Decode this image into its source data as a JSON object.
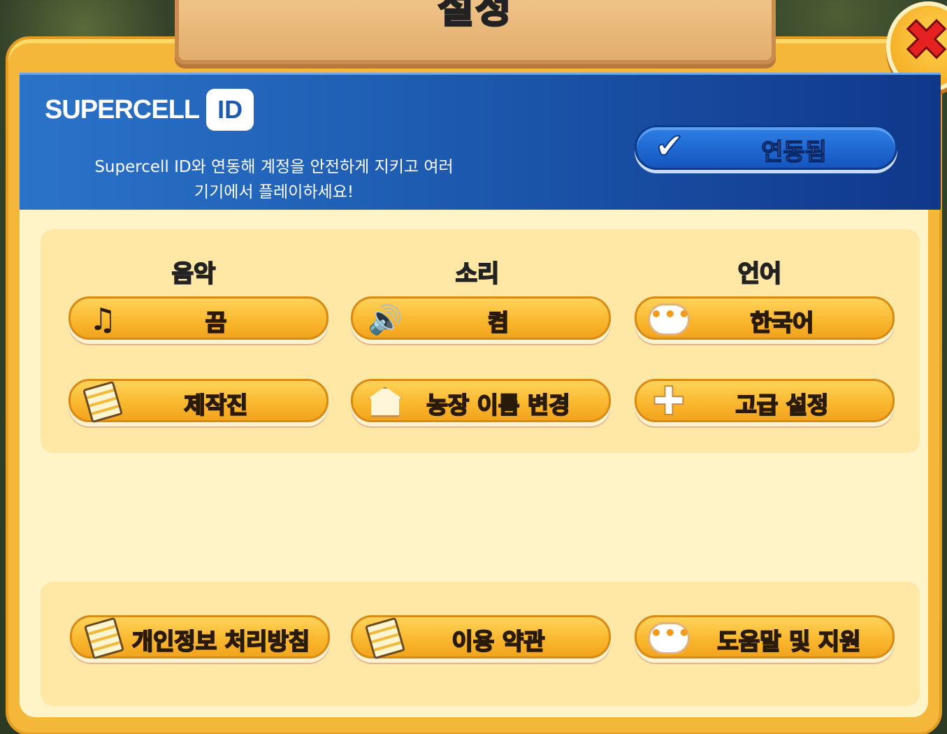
{
  "title": "설정",
  "close_icon": "close-icon",
  "supercell": {
    "logo_text": "SUPERCELL",
    "logo_badge": "ID",
    "description_line1": "Supercell ID와 연동해 계정을 안전하게 지키고 여러",
    "description_line2": "기기에서 플레이하세요!",
    "linked_button": "연동됨"
  },
  "settings": {
    "music_label": "음악",
    "sound_label": "소리",
    "language_label": "언어",
    "music_button": "끔",
    "sound_button": "켬",
    "language_button": "한국어",
    "credits_button": "제작진",
    "rename_farm_button": "농장 이름 변경",
    "advanced_button": "고급 설정"
  },
  "footer": {
    "privacy_button": "개인정보 처리방침",
    "terms_button": "이용 약관",
    "help_button": "도움말 및 지원"
  },
  "icons": [
    "music-note-icon",
    "speaker-icon",
    "chat-bubble-icon",
    "document-icon",
    "house-icon",
    "plus-icon",
    "check-icon"
  ]
}
